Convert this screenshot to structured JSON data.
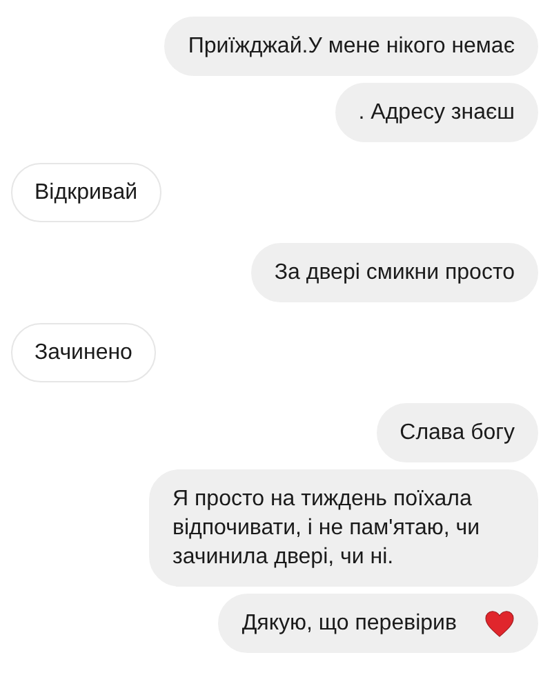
{
  "messages": [
    {
      "kind": "sent",
      "text": "Приїжджай.У мене нікого немає"
    },
    {
      "kind": "sent",
      "text": ". Адресу знаєш"
    },
    {
      "kind": "received",
      "text": "Відкривай"
    },
    {
      "kind": "sent",
      "text": "За двері смикни просто"
    },
    {
      "kind": "received",
      "text": "Зачинено"
    },
    {
      "kind": "sent",
      "text": "Слава богу"
    },
    {
      "kind": "sent",
      "text": "Я просто на тиждень поїхала відпочивати, і не пам'ятаю, чи зачинила двері, чи ні."
    },
    {
      "kind": "sent",
      "text": "Дякую, що перевірив",
      "heart": true
    }
  ]
}
